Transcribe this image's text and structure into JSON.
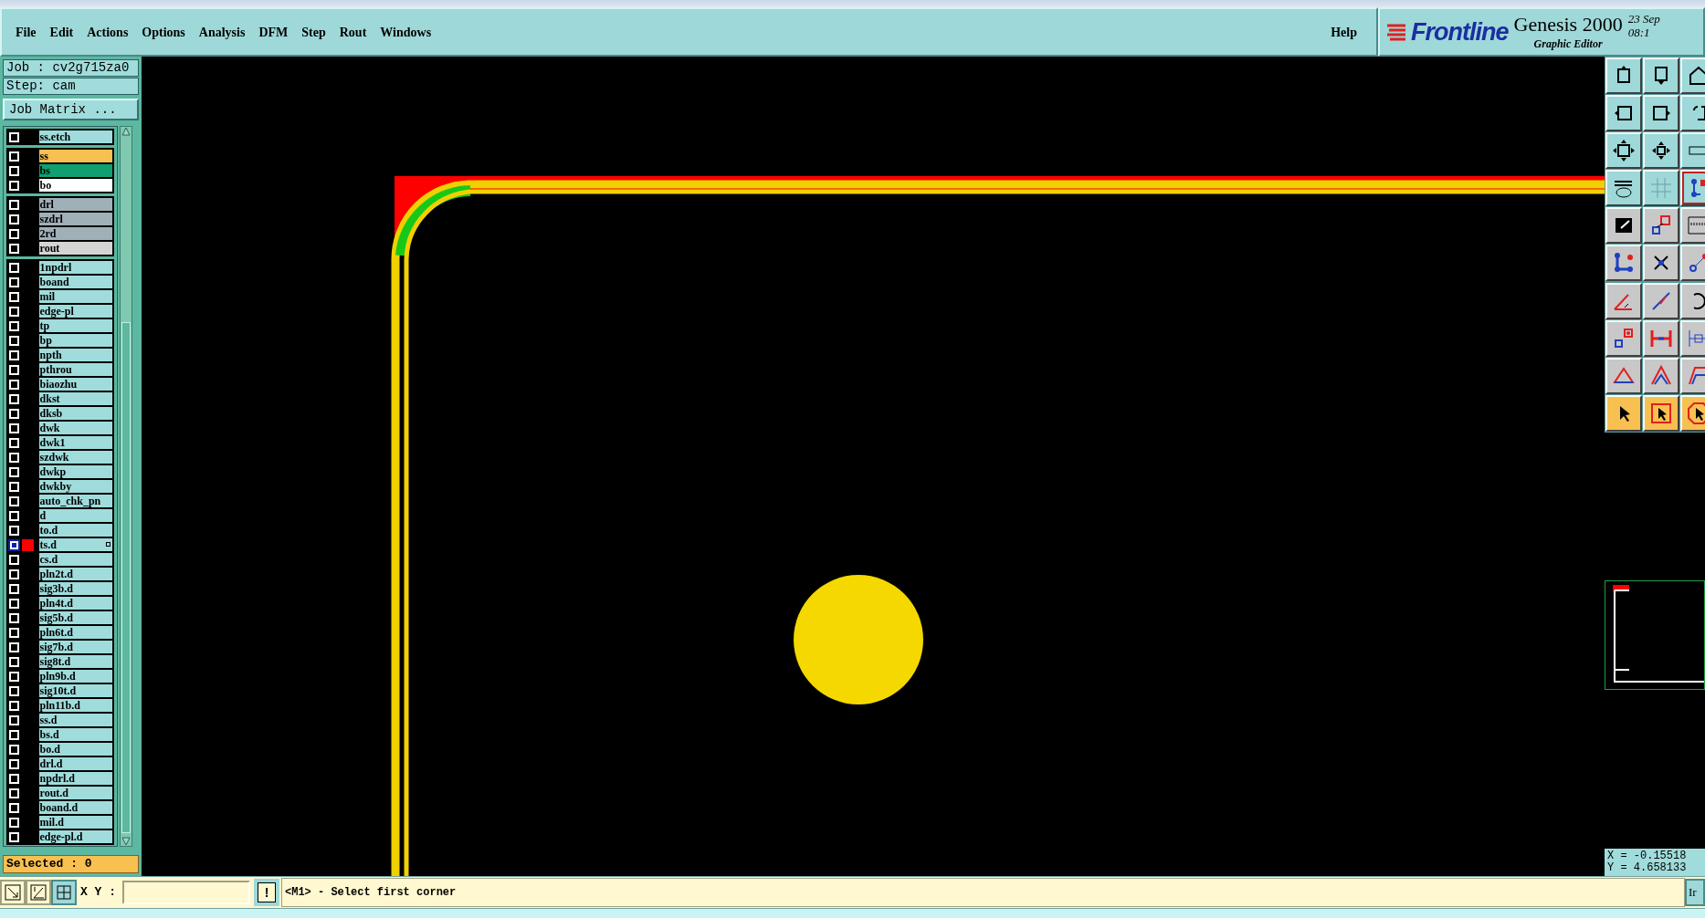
{
  "menu": [
    "File",
    "Edit",
    "Actions",
    "Options",
    "Analysis",
    "DFM",
    "Step",
    "Rout",
    "Windows"
  ],
  "help": "Help",
  "brand": {
    "logo": "Frontline",
    "product": "Genesis 2000",
    "subtitle": "Graphic Editor",
    "date": "23 Sep",
    "time": "08:1"
  },
  "job": {
    "job": "Job : cv2g715za0",
    "step": "Step: cam",
    "matrix_button": "Job Matrix ..."
  },
  "layer_groups": [
    [
      {
        "name": "ss.etch",
        "color": "#a0dcdc",
        "work": false
      }
    ],
    [
      {
        "name": "ss",
        "color": "#f8c050",
        "work": false
      },
      {
        "name": "bs",
        "color": "#10a070",
        "work": false
      },
      {
        "name": "bo",
        "color": "#ffffff",
        "work": false
      }
    ],
    [
      {
        "name": "drl",
        "color": "#a0b0b8",
        "work": false
      },
      {
        "name": "szdrl",
        "color": "#a0b0b8",
        "work": false
      },
      {
        "name": "2rd",
        "color": "#a0b0b8",
        "work": false
      },
      {
        "name": "rout",
        "color": "#d4d4d4",
        "work": false
      }
    ],
    [
      {
        "name": "1npdrl",
        "color": "#a0dcdc",
        "work": false
      },
      {
        "name": "boand",
        "color": "#a0dcdc",
        "work": false
      },
      {
        "name": "mil",
        "color": "#a0dcdc",
        "work": false
      },
      {
        "name": "edge-pl",
        "color": "#a0dcdc",
        "work": false
      },
      {
        "name": "tp",
        "color": "#a0dcdc",
        "work": false
      },
      {
        "name": "bp",
        "color": "#a0dcdc",
        "work": false
      },
      {
        "name": "npth",
        "color": "#a0dcdc",
        "work": false
      },
      {
        "name": "pthrou",
        "color": "#a0dcdc",
        "work": false
      },
      {
        "name": "biaozhu",
        "color": "#a0dcdc",
        "work": false
      },
      {
        "name": "dkst",
        "color": "#a0dcdc",
        "work": false
      },
      {
        "name": "dksb",
        "color": "#a0dcdc",
        "work": false
      },
      {
        "name": "dwk",
        "color": "#a0dcdc",
        "work": false
      },
      {
        "name": "dwk1",
        "color": "#a0dcdc",
        "work": false
      },
      {
        "name": "szdwk",
        "color": "#a0dcdc",
        "work": false
      },
      {
        "name": "dwkp",
        "color": "#a0dcdc",
        "work": false
      },
      {
        "name": "dwkby",
        "color": "#a0dcdc",
        "work": false
      },
      {
        "name": "auto_chk_pn",
        "color": "#a0dcdc",
        "work": false
      },
      {
        "name": "d",
        "color": "#a0dcdc",
        "work": false
      },
      {
        "name": "to.d",
        "color": "#a0dcdc",
        "work": false
      },
      {
        "name": "ts.d",
        "color": "#a0dcdc",
        "work": true
      },
      {
        "name": "cs.d",
        "color": "#a0dcdc",
        "work": false
      },
      {
        "name": "pln2t.d",
        "color": "#a0dcdc",
        "work": false
      },
      {
        "name": "sig3b.d",
        "color": "#a0dcdc",
        "work": false
      },
      {
        "name": "pln4t.d",
        "color": "#a0dcdc",
        "work": false
      },
      {
        "name": "sig5b.d",
        "color": "#a0dcdc",
        "work": false
      },
      {
        "name": "pln6t.d",
        "color": "#a0dcdc",
        "work": false
      },
      {
        "name": "sig7b.d",
        "color": "#a0dcdc",
        "work": false
      },
      {
        "name": "sig8t.d",
        "color": "#a0dcdc",
        "work": false
      },
      {
        "name": "pln9b.d",
        "color": "#a0dcdc",
        "work": false
      },
      {
        "name": "sig10t.d",
        "color": "#a0dcdc",
        "work": false
      },
      {
        "name": "pln11b.d",
        "color": "#a0dcdc",
        "work": false
      },
      {
        "name": "ss.d",
        "color": "#a0dcdc",
        "work": false
      },
      {
        "name": "bs.d",
        "color": "#a0dcdc",
        "work": false
      },
      {
        "name": "bo.d",
        "color": "#a0dcdc",
        "work": false
      },
      {
        "name": "drl.d",
        "color": "#a0dcdc",
        "work": false
      },
      {
        "name": "npdrl.d",
        "color": "#a0dcdc",
        "work": false
      },
      {
        "name": "rout.d",
        "color": "#a0dcdc",
        "work": false
      },
      {
        "name": "boand.d",
        "color": "#a0dcdc",
        "work": false
      },
      {
        "name": "mil.d",
        "color": "#a0dcdc",
        "work": false
      },
      {
        "name": "edge-pl.d",
        "color": "#a0dcdc",
        "work": false
      }
    ]
  ],
  "selected_count": "Selected : 0",
  "coords": {
    "x": "X = -0.15518",
    "y": "Y = 4.658133"
  },
  "bottom": {
    "xy_label": "X Y :",
    "alert_button": "!",
    "message": "<M1> - Select first corner",
    "right_button": "Ir"
  }
}
